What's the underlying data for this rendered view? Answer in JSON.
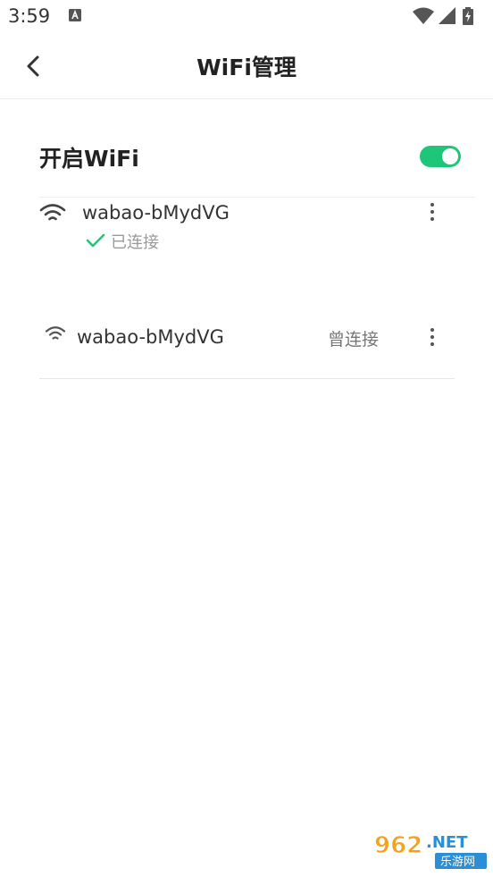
{
  "status_bar": {
    "time": "3:59",
    "notification_icon": "a-icon",
    "icons": [
      "wifi-signal-icon",
      "cell-signal-icon",
      "battery-charging-icon"
    ]
  },
  "header": {
    "back_icon": "chevron-left-icon",
    "title": "WiFi管理"
  },
  "wifi_toggle": {
    "label": "开启WiFi",
    "enabled": true,
    "color": "#1fc67a"
  },
  "networks": {
    "connected": {
      "ssid": "wabao-bMydVG",
      "status": "已连接",
      "status_icon": "check-icon",
      "status_color": "#1fc67a"
    },
    "saved": {
      "ssid": "wabao-bMydVG",
      "status": "曾连接"
    }
  },
  "watermark": {
    "text": "962.NET",
    "subtext": "乐游网"
  }
}
